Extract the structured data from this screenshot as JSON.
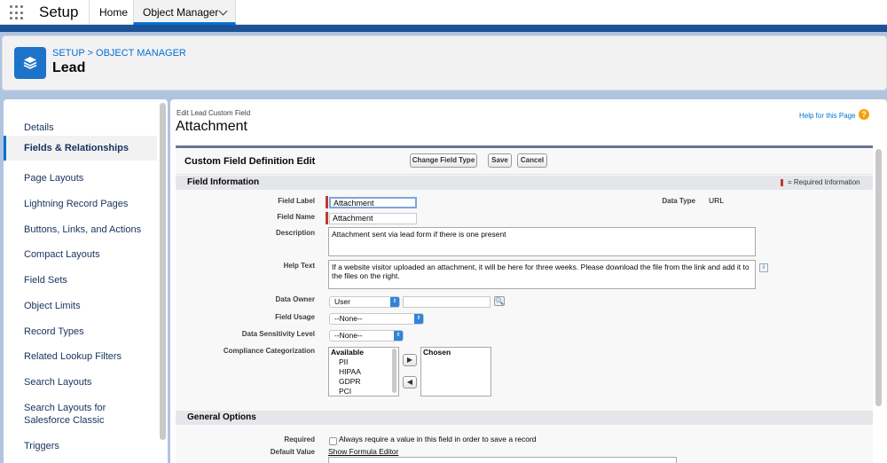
{
  "nav": {
    "app_name": "Setup",
    "tabs": [
      {
        "label": "Home"
      },
      {
        "label": "Object Manager"
      }
    ]
  },
  "header": {
    "breadcrumb": "SETUP > OBJECT MANAGER",
    "object_name": "Lead"
  },
  "sidebar": {
    "items": [
      {
        "label": "Details"
      },
      {
        "label": "Fields & Relationships",
        "active": true
      },
      {
        "label": "Page Layouts"
      },
      {
        "label": "Lightning Record Pages"
      },
      {
        "label": "Buttons, Links, and Actions"
      },
      {
        "label": "Compact Layouts"
      },
      {
        "label": "Field Sets"
      },
      {
        "label": "Object Limits"
      },
      {
        "label": "Record Types"
      },
      {
        "label": "Related Lookup Filters"
      },
      {
        "label": "Search Layouts"
      },
      {
        "label": "Search Layouts for Salesforce Classic"
      },
      {
        "label": "Triggers"
      }
    ]
  },
  "page": {
    "edit_label": "Edit Lead Custom Field",
    "title": "Attachment",
    "help_link": "Help for this Page",
    "help_icon": "?"
  },
  "form": {
    "heading": "Custom Field Definition Edit",
    "buttons": {
      "change_type": "Change Field Type",
      "save": "Save",
      "cancel": "Cancel"
    },
    "required_info": "= Required Information",
    "sections": {
      "field_info": "Field Information",
      "general": "General Options"
    },
    "fields": {
      "field_label": {
        "label": "Field Label",
        "value": "Attachment"
      },
      "field_name": {
        "label": "Field Name",
        "value": "Attachment"
      },
      "data_type": {
        "label": "Data Type",
        "value": "URL"
      },
      "description": {
        "label": "Description",
        "value": "Attachment sent via lead form if there is one present"
      },
      "help_text": {
        "label": "Help Text",
        "value": "If a website visitor uploaded an attachment, it will be here for three weeks. Please download the file from the link and add it to the files on the right."
      },
      "data_owner": {
        "label": "Data Owner",
        "type_value": "User",
        "lookup_value": ""
      },
      "field_usage": {
        "label": "Field Usage",
        "value": "--None--"
      },
      "sensitivity": {
        "label": "Data Sensitivity Level",
        "value": "--None--"
      },
      "compliance": {
        "label": "Compliance Categorization",
        "available_header": "Available",
        "available": [
          "PII",
          "HIPAA",
          "GDPR",
          "PCI"
        ],
        "chosen_header": "Chosen",
        "add_glyph": "▶",
        "remove_glyph": "◀"
      },
      "required": {
        "label": "Required",
        "text": "Always require a value in this field in order to save a record"
      },
      "default_value": {
        "label": "Default Value",
        "link": "Show Formula Editor"
      }
    }
  },
  "colors": {
    "brand_band": "#1b5297",
    "accent": "#0070d2",
    "required": "#c23934",
    "select_arrow": "#2f84d8"
  },
  "icons": [
    "app-launcher-icon",
    "chevron-down-icon",
    "layers-icon",
    "help-icon",
    "info-icon",
    "lookup-icon",
    "sort-arrows-icon",
    "move-right-icon",
    "move-left-icon"
  ]
}
